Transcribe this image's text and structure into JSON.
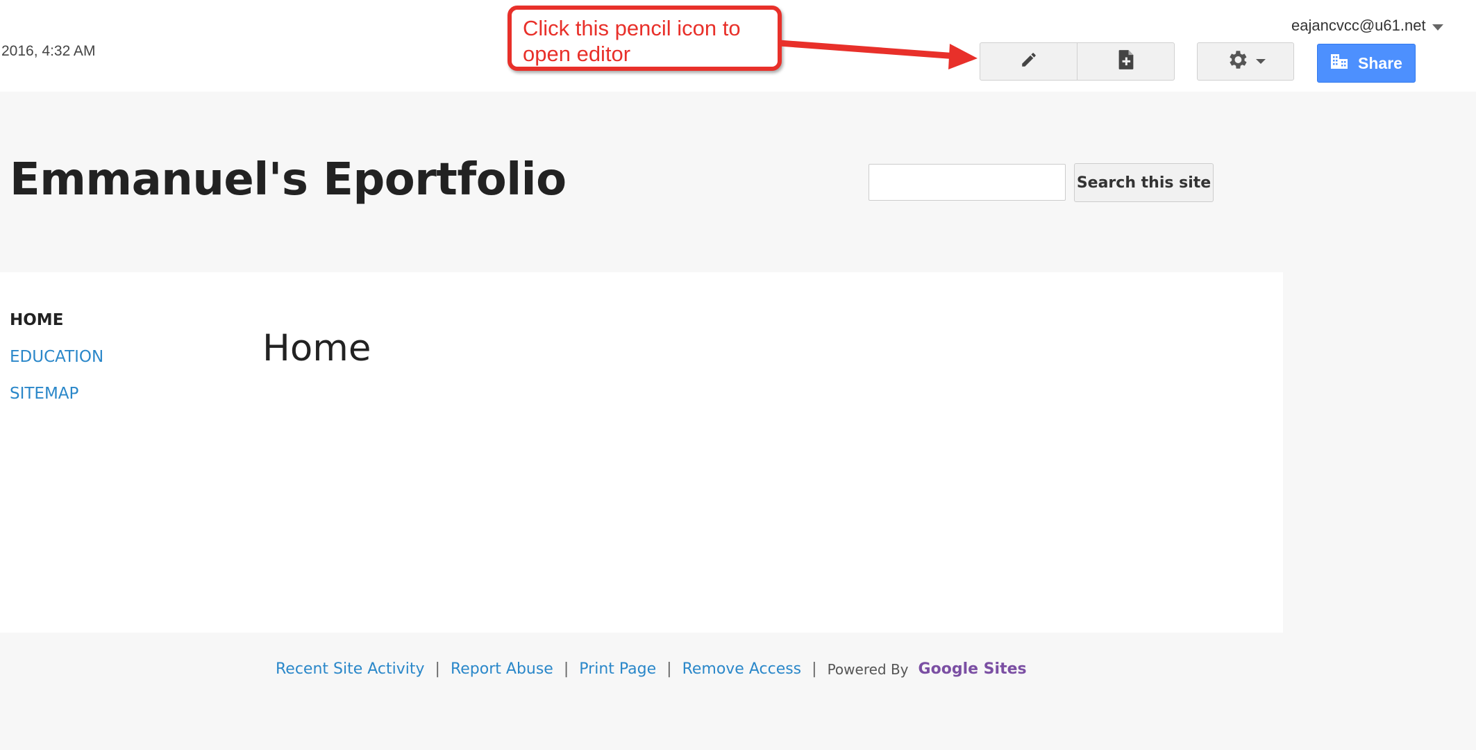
{
  "topbar": {
    "timestamp": "2016, 4:32 AM",
    "user_email": "eajancvcc@u61.net",
    "share_label": "Share",
    "icons": [
      "pencil-icon",
      "new-page-icon",
      "gear-icon",
      "chevron-down-icon",
      "building-icon"
    ]
  },
  "annotation": {
    "text": "Click this pencil icon to open editor",
    "color": "#e8302a"
  },
  "header": {
    "site_title": "Emmanuel's Eportfolio",
    "search_placeholder": "",
    "search_button": "Search this site"
  },
  "nav": {
    "items": [
      {
        "label": "HOME",
        "active": true
      },
      {
        "label": "EDUCATION",
        "active": false
      },
      {
        "label": "SITEMAP",
        "active": false
      }
    ]
  },
  "main": {
    "page_heading": "Home"
  },
  "footer": {
    "links": [
      "Recent Site Activity",
      "Report Abuse",
      "Print Page",
      "Remove Access"
    ],
    "powered_by": "Powered By",
    "brand": "Google Sites"
  },
  "colors": {
    "link": "#2a87c9",
    "share_blue": "#4d90fe",
    "brand_purple": "#7b4fa3",
    "annotation_red": "#e8302a"
  }
}
